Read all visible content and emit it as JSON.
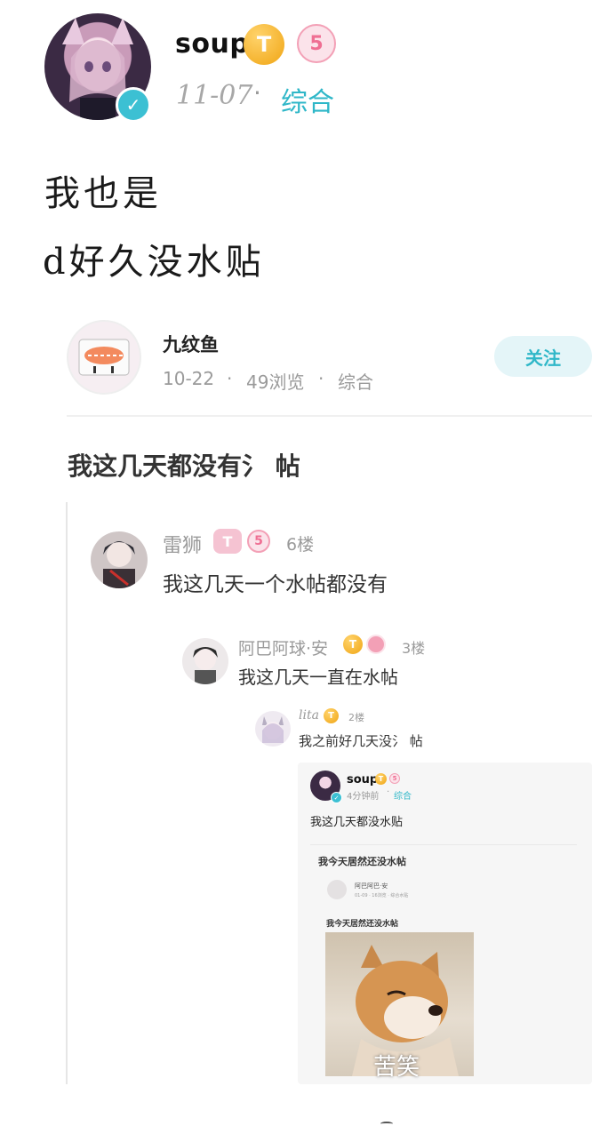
{
  "post": {
    "author": "soup",
    "date": "11-07",
    "separator": "·",
    "category": "综合",
    "body_line1": "我也是",
    "body_line2": "d好久没水贴",
    "badge_t": "T",
    "badge_level": "5"
  },
  "quoted": {
    "author": "九纹鱼",
    "date": "10-22",
    "views": "49浏览",
    "category": "综合",
    "sep": "·",
    "follow_label": "关注",
    "title": "我这几天都没有氵 帖"
  },
  "comment1": {
    "author": "雷狮",
    "badge_t": "T",
    "badge_level": "5",
    "floor": "6楼",
    "text": "我这几天一个水帖都没有"
  },
  "comment2": {
    "author": "阿巴阿球·安",
    "floor": "3楼",
    "text": "我这几天一直在水帖"
  },
  "comment3": {
    "author": "lita",
    "floor": "2楼",
    "text": "我之前好几天没氵 帖"
  },
  "nested": {
    "author": "soup",
    "time": "4分钟前",
    "sep": "·",
    "category": "综合",
    "text": "我这几天都没水贴",
    "inner_title": "我今天居然还没水帖",
    "inner_author": "阿巴阿巴·安",
    "inner_meta": "01-09 · 16浏览 · 综合水贴",
    "inner_text": "我今天居然还没水帖",
    "meme_caption": "苦笑"
  }
}
